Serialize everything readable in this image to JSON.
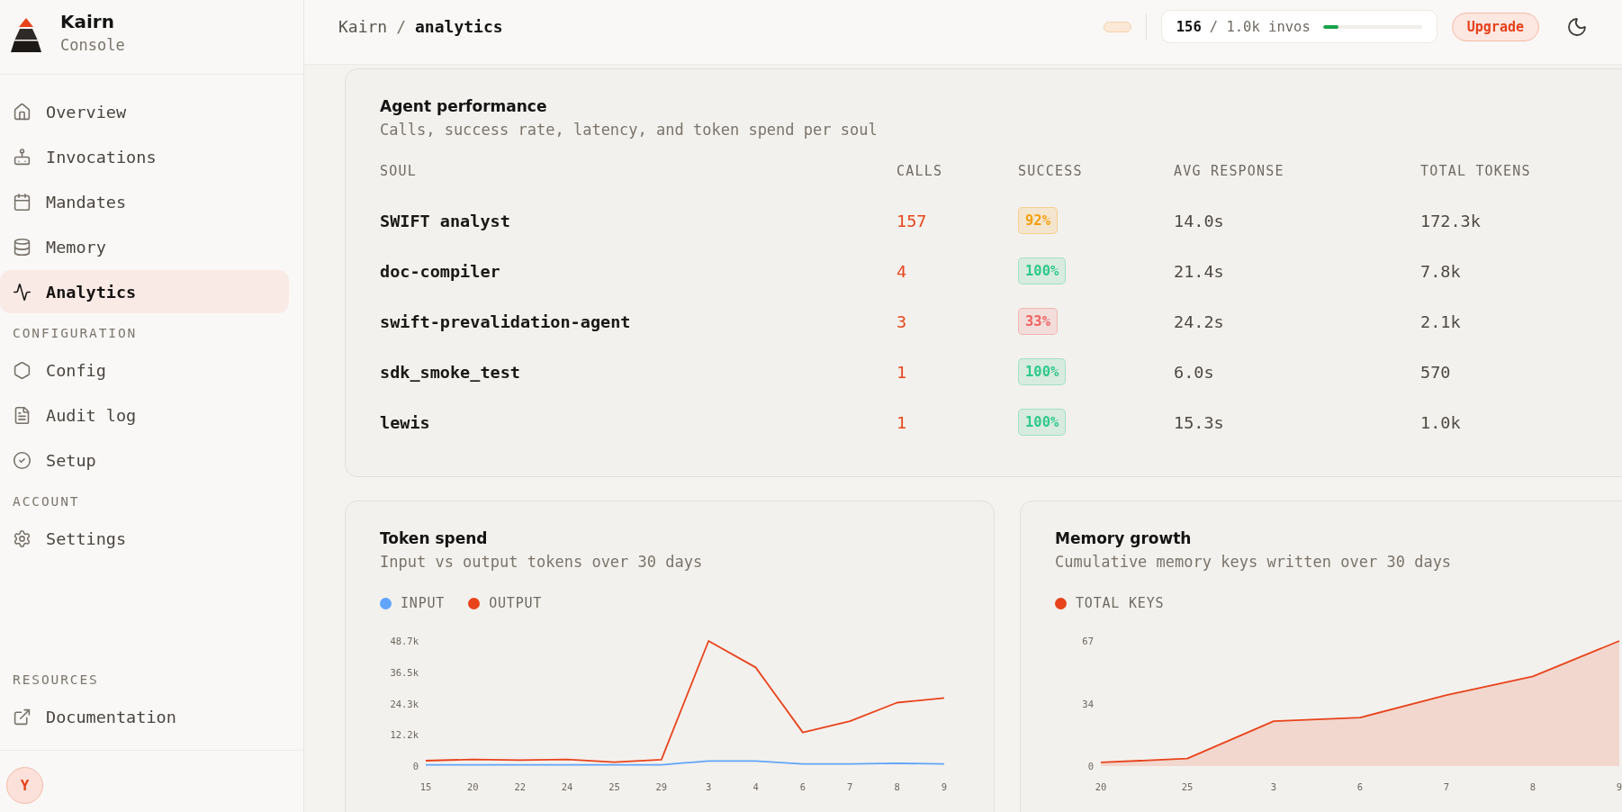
{
  "sidebar": {
    "brand": {
      "name": "Kairn",
      "subtitle": "Console"
    },
    "sections": [
      {
        "items": [
          {
            "label": "Overview",
            "selected": false
          },
          {
            "label": "Invocations",
            "selected": false
          },
          {
            "label": "Mandates",
            "selected": false
          },
          {
            "label": "Memory",
            "selected": false
          },
          {
            "label": "Analytics",
            "selected": true
          }
        ]
      },
      {
        "label": "CONFIGURATION",
        "items": [
          {
            "label": "Config",
            "selected": false
          },
          {
            "label": "Audit log",
            "selected": false
          },
          {
            "label": "Setup",
            "selected": false
          }
        ]
      },
      {
        "label": "ACCOUNT",
        "items": [
          {
            "label": "Settings",
            "selected": false
          }
        ]
      }
    ],
    "resources": {
      "label": "RESOURCES",
      "items": [
        {
          "label": "Documentation",
          "selected": false
        }
      ]
    },
    "user": {
      "initial": "Y"
    }
  },
  "header": {
    "breadcrumb": [
      {
        "label": "Kairn"
      },
      {
        "label": "analytics"
      }
    ],
    "separator": "/",
    "usage": {
      "used": "156",
      "total": "/ 1.0k invos",
      "level": 0.156
    },
    "upgrade_button": "Upgrade"
  },
  "agent_performance": {
    "title": "Agent performance",
    "subtitle": "Calls, success rate, latency, and token spend per soul",
    "columns": [
      "SOUL",
      "CALLS",
      "SUCCESS",
      "AVG RESPONSE",
      "TOTAL TOKENS"
    ],
    "rows": [
      {
        "soul": "SWIFT analyst",
        "calls": "157",
        "success": {
          "text": "92%",
          "color": "#f59e0b"
        },
        "avg_response": "14.0s",
        "total_tokens": "172.3k"
      },
      {
        "soul": "doc-compiler",
        "calls": "4",
        "success": {
          "text": "100%",
          "color": "#2ec98a"
        },
        "avg_response": "21.4s",
        "total_tokens": "7.8k"
      },
      {
        "soul": "swift-prevalidation-agent",
        "calls": "3",
        "success": {
          "text": "33%",
          "color": "#ef6461"
        },
        "avg_response": "24.2s",
        "total_tokens": "2.1k"
      },
      {
        "soul": "sdk_smoke_test",
        "calls": "1",
        "success": {
          "text": "100%",
          "color": "#2ec98a"
        },
        "avg_response": "6.0s",
        "total_tokens": "570"
      },
      {
        "soul": "lewis",
        "calls": "1",
        "success": {
          "text": "100%",
          "color": "#2ec98a"
        },
        "avg_response": "15.3s",
        "total_tokens": "1.0k"
      }
    ]
  },
  "charts": [
    {
      "title": "Token spend",
      "subtitle": "Input vs output tokens over 30 days",
      "chart_data": {
        "type": "line",
        "categories": [
          "15",
          "20",
          "22",
          "24",
          "25",
          "29",
          "3",
          "4",
          "6",
          "7",
          "8",
          "9"
        ],
        "series": [
          {
            "name": "INPUT",
            "color": "#60a5fa",
            "values": [
              500,
              500,
              500,
              500,
              500,
              500,
              2000,
              2000,
              800,
              800,
              1100,
              800
            ]
          },
          {
            "name": "OUTPUT",
            "color": "#e8431c",
            "values": [
              2100,
              2600,
              2300,
              2600,
              1500,
              2500,
              48700,
              38400,
              13100,
              17500,
              24700,
              26500
            ]
          }
        ],
        "ylim": [
          0,
          48700
        ],
        "yticks": [
          {
            "value": 0,
            "label": "0"
          },
          {
            "value": 12175,
            "label": "12.2k"
          },
          {
            "value": 24350,
            "label": "24.3k"
          },
          {
            "value": 36525,
            "label": "36.5k"
          },
          {
            "value": 48700,
            "label": "48.7k"
          }
        ]
      }
    },
    {
      "title": "Memory growth",
      "subtitle": "Cumulative memory keys written over 30 days",
      "chart_data": {
        "type": "area",
        "categories": [
          "20",
          "25",
          "3",
          "6",
          "7",
          "8",
          "9"
        ],
        "series": [
          {
            "name": "TOTAL KEYS",
            "color": "#e8431c",
            "values": [
              2,
              4,
              24,
              26,
              38,
              48,
              67
            ]
          }
        ],
        "ylim": [
          0,
          67
        ],
        "yticks": [
          {
            "value": 0,
            "label": "0"
          },
          {
            "value": 33.5,
            "label": "34"
          },
          {
            "value": 67,
            "label": "67"
          }
        ]
      }
    }
  ]
}
